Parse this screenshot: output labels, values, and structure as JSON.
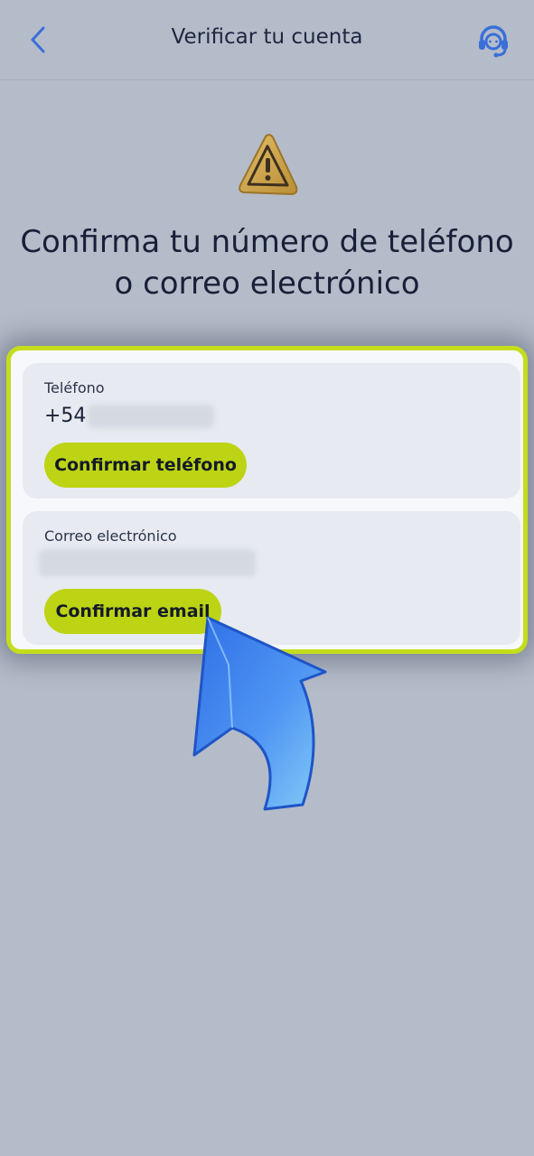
{
  "header": {
    "title": "Verificar tu cuenta"
  },
  "main": {
    "headline": "Confirma tu número de teléfono o correo electrónico"
  },
  "phone_card": {
    "label": "Teléfono",
    "prefix": "+54",
    "button_label": "Confirmar teléfono"
  },
  "email_card": {
    "label": "Correo electrónico",
    "button_label": "Confirmar email"
  },
  "icons": {
    "back": "chevron-left-icon",
    "support": "headset-icon",
    "warning": "warning-icon",
    "pointer": "arrow-pointer-icon"
  },
  "colors": {
    "accent": "#c4dd1c",
    "button": "#bcd414",
    "background": "#b5bcc9",
    "primary_blue": "#3a6fd8"
  }
}
